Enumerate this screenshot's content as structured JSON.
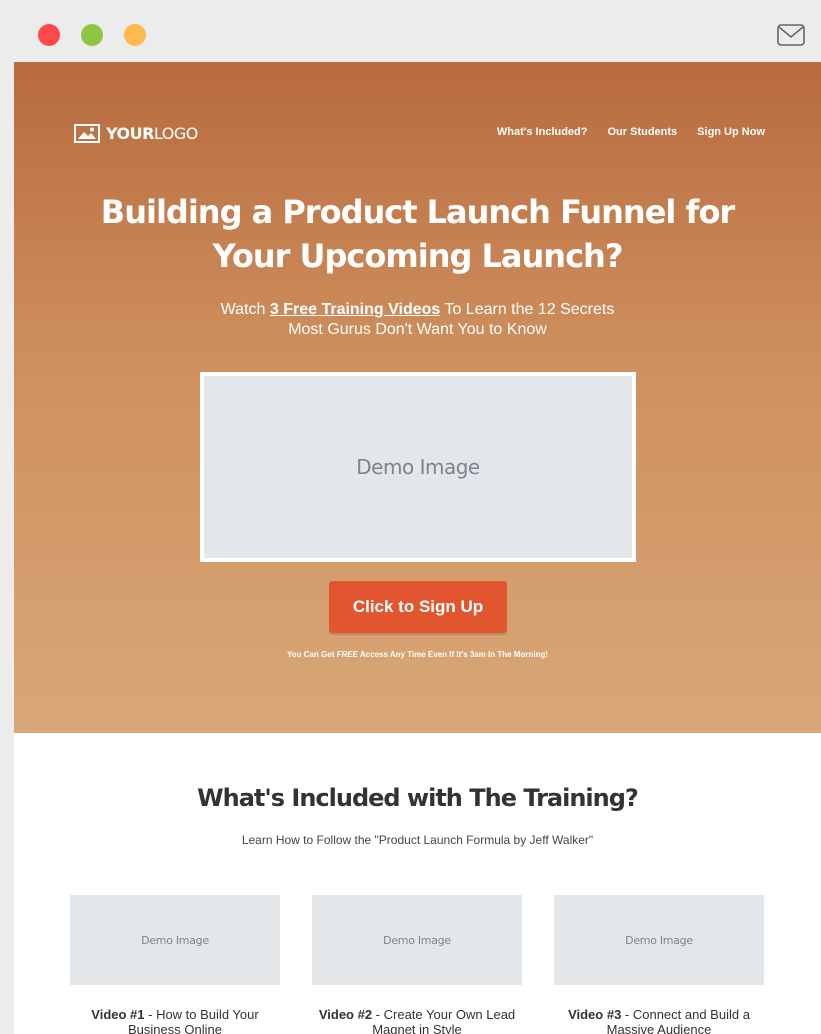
{
  "window": {
    "controls": [
      "close",
      "minimize",
      "maximize"
    ],
    "icon": "mail-icon"
  },
  "header": {
    "logo_bold": "YOUR",
    "logo_light": "LOGO",
    "nav": [
      {
        "label": "What's Included?"
      },
      {
        "label": "Our Students"
      },
      {
        "label": "Sign Up Now"
      }
    ]
  },
  "hero": {
    "title_line1": "Building a Product Launch Funnel for",
    "title_line2": "Your Upcoming Launch?",
    "sub_prefix": "Watch ",
    "sub_highlight": "3 Free Training Videos",
    "sub_suffix": " To Learn the 12 Secrets",
    "sub_line2": "Most Gurus Don't Want You to Know",
    "demo_label": "Demo Image",
    "cta_label": "Click to Sign Up",
    "note_prefix": "You Can Get ",
    "note_em": "FREE",
    "note_suffix": " Access Any Time Even If It's 3am In The Morning!"
  },
  "section": {
    "title": "What's Included with The Training?",
    "subtitle": "Learn How to Follow the \"Product Launch Formula by Jeff Walker\"",
    "cards": [
      {
        "image_label": "Demo Image",
        "num": "Video #1",
        "text": " - How to Build Your Business Online"
      },
      {
        "image_label": "Demo Image",
        "num": "Video #2",
        "text": " - Create Your Own Lead Magnet in Style"
      },
      {
        "image_label": "Demo Image",
        "num": "Video #3",
        "text": " - Connect and Build a Massive Audience"
      }
    ]
  },
  "colors": {
    "hero_top": "#b86b3e",
    "hero_bottom": "#d8a778",
    "cta": "#e2562f",
    "dot_red": "#fc4a4a",
    "dot_green": "#8cc53f",
    "dot_yellow": "#feb94f"
  }
}
